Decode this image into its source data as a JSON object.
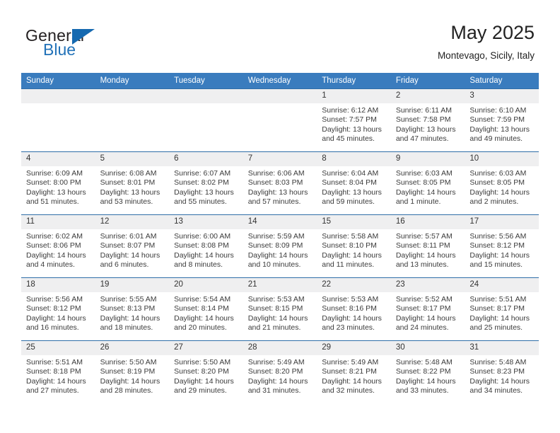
{
  "brand": {
    "name_part1": "General",
    "name_part2": "Blue",
    "logo_icon": "triangle-logo-icon"
  },
  "header": {
    "title": "May 2025",
    "location": "Montevago, Sicily, Italy"
  },
  "calendar": {
    "weekday_headers": [
      "Sunday",
      "Monday",
      "Tuesday",
      "Wednesday",
      "Thursday",
      "Friday",
      "Saturday"
    ],
    "accent_color": "#3a7cbe",
    "grid_line_color": "#2f6ea8",
    "daynum_band_color": "#efeff0",
    "weeks": [
      [
        {
          "day": "",
          "info": ""
        },
        {
          "day": "",
          "info": ""
        },
        {
          "day": "",
          "info": ""
        },
        {
          "day": "",
          "info": ""
        },
        {
          "day": "1",
          "info": "Sunrise: 6:12 AM\nSunset: 7:57 PM\nDaylight: 13 hours\nand 45 minutes."
        },
        {
          "day": "2",
          "info": "Sunrise: 6:11 AM\nSunset: 7:58 PM\nDaylight: 13 hours\nand 47 minutes."
        },
        {
          "day": "3",
          "info": "Sunrise: 6:10 AM\nSunset: 7:59 PM\nDaylight: 13 hours\nand 49 minutes."
        }
      ],
      [
        {
          "day": "4",
          "info": "Sunrise: 6:09 AM\nSunset: 8:00 PM\nDaylight: 13 hours\nand 51 minutes."
        },
        {
          "day": "5",
          "info": "Sunrise: 6:08 AM\nSunset: 8:01 PM\nDaylight: 13 hours\nand 53 minutes."
        },
        {
          "day": "6",
          "info": "Sunrise: 6:07 AM\nSunset: 8:02 PM\nDaylight: 13 hours\nand 55 minutes."
        },
        {
          "day": "7",
          "info": "Sunrise: 6:06 AM\nSunset: 8:03 PM\nDaylight: 13 hours\nand 57 minutes."
        },
        {
          "day": "8",
          "info": "Sunrise: 6:04 AM\nSunset: 8:04 PM\nDaylight: 13 hours\nand 59 minutes."
        },
        {
          "day": "9",
          "info": "Sunrise: 6:03 AM\nSunset: 8:05 PM\nDaylight: 14 hours\nand 1 minute."
        },
        {
          "day": "10",
          "info": "Sunrise: 6:03 AM\nSunset: 8:05 PM\nDaylight: 14 hours\nand 2 minutes."
        }
      ],
      [
        {
          "day": "11",
          "info": "Sunrise: 6:02 AM\nSunset: 8:06 PM\nDaylight: 14 hours\nand 4 minutes."
        },
        {
          "day": "12",
          "info": "Sunrise: 6:01 AM\nSunset: 8:07 PM\nDaylight: 14 hours\nand 6 minutes."
        },
        {
          "day": "13",
          "info": "Sunrise: 6:00 AM\nSunset: 8:08 PM\nDaylight: 14 hours\nand 8 minutes."
        },
        {
          "day": "14",
          "info": "Sunrise: 5:59 AM\nSunset: 8:09 PM\nDaylight: 14 hours\nand 10 minutes."
        },
        {
          "day": "15",
          "info": "Sunrise: 5:58 AM\nSunset: 8:10 PM\nDaylight: 14 hours\nand 11 minutes."
        },
        {
          "day": "16",
          "info": "Sunrise: 5:57 AM\nSunset: 8:11 PM\nDaylight: 14 hours\nand 13 minutes."
        },
        {
          "day": "17",
          "info": "Sunrise: 5:56 AM\nSunset: 8:12 PM\nDaylight: 14 hours\nand 15 minutes."
        }
      ],
      [
        {
          "day": "18",
          "info": "Sunrise: 5:56 AM\nSunset: 8:12 PM\nDaylight: 14 hours\nand 16 minutes."
        },
        {
          "day": "19",
          "info": "Sunrise: 5:55 AM\nSunset: 8:13 PM\nDaylight: 14 hours\nand 18 minutes."
        },
        {
          "day": "20",
          "info": "Sunrise: 5:54 AM\nSunset: 8:14 PM\nDaylight: 14 hours\nand 20 minutes."
        },
        {
          "day": "21",
          "info": "Sunrise: 5:53 AM\nSunset: 8:15 PM\nDaylight: 14 hours\nand 21 minutes."
        },
        {
          "day": "22",
          "info": "Sunrise: 5:53 AM\nSunset: 8:16 PM\nDaylight: 14 hours\nand 23 minutes."
        },
        {
          "day": "23",
          "info": "Sunrise: 5:52 AM\nSunset: 8:17 PM\nDaylight: 14 hours\nand 24 minutes."
        },
        {
          "day": "24",
          "info": "Sunrise: 5:51 AM\nSunset: 8:17 PM\nDaylight: 14 hours\nand 25 minutes."
        }
      ],
      [
        {
          "day": "25",
          "info": "Sunrise: 5:51 AM\nSunset: 8:18 PM\nDaylight: 14 hours\nand 27 minutes."
        },
        {
          "day": "26",
          "info": "Sunrise: 5:50 AM\nSunset: 8:19 PM\nDaylight: 14 hours\nand 28 minutes."
        },
        {
          "day": "27",
          "info": "Sunrise: 5:50 AM\nSunset: 8:20 PM\nDaylight: 14 hours\nand 29 minutes."
        },
        {
          "day": "28",
          "info": "Sunrise: 5:49 AM\nSunset: 8:20 PM\nDaylight: 14 hours\nand 31 minutes."
        },
        {
          "day": "29",
          "info": "Sunrise: 5:49 AM\nSunset: 8:21 PM\nDaylight: 14 hours\nand 32 minutes."
        },
        {
          "day": "30",
          "info": "Sunrise: 5:48 AM\nSunset: 8:22 PM\nDaylight: 14 hours\nand 33 minutes."
        },
        {
          "day": "31",
          "info": "Sunrise: 5:48 AM\nSunset: 8:23 PM\nDaylight: 14 hours\nand 34 minutes."
        }
      ]
    ]
  }
}
